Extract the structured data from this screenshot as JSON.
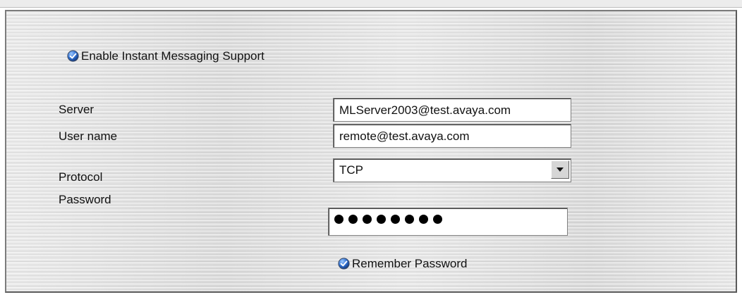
{
  "enable_im": {
    "label": "Enable Instant Messaging Support",
    "checked": true
  },
  "form": {
    "server": {
      "label": "Server",
      "value": "MLServer2003@test.avaya.com"
    },
    "username": {
      "label": "User name",
      "value": "remote@test.avaya.com"
    },
    "protocol": {
      "label": "Protocol",
      "value": "TCP"
    },
    "password": {
      "label": "Password",
      "masked_length": 8
    }
  },
  "remember_password": {
    "label": "Remember Password",
    "checked": true
  },
  "colors": {
    "check_blue": "#2f6fd0",
    "panel_bg": "#e4e4e4"
  }
}
